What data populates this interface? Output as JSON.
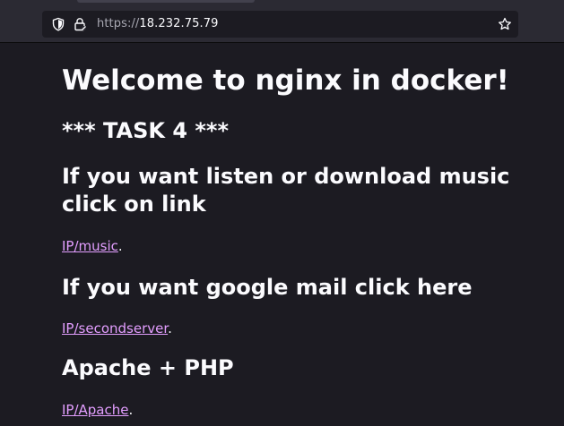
{
  "browser": {
    "url_scheme": "https://",
    "url_host": "18.232.75.79",
    "icons": [
      "shield-icon",
      "lock-icon",
      "star-icon"
    ]
  },
  "page": {
    "title": "Welcome to nginx in docker!",
    "task_heading": "*** TASK 4 ***",
    "sections": [
      {
        "heading": "If you want listen or download music click on link",
        "link_text": "IP/music",
        "suffix": "."
      },
      {
        "heading": "If you want google mail click here",
        "link_text": "IP/secondserver",
        "suffix": "."
      },
      {
        "heading": "Apache + PHP",
        "link_text": "IP/Apache",
        "suffix": "."
      }
    ]
  },
  "colors": {
    "background": "#1c1b22",
    "text": "#fbfbfe",
    "link": "#e39eff"
  }
}
